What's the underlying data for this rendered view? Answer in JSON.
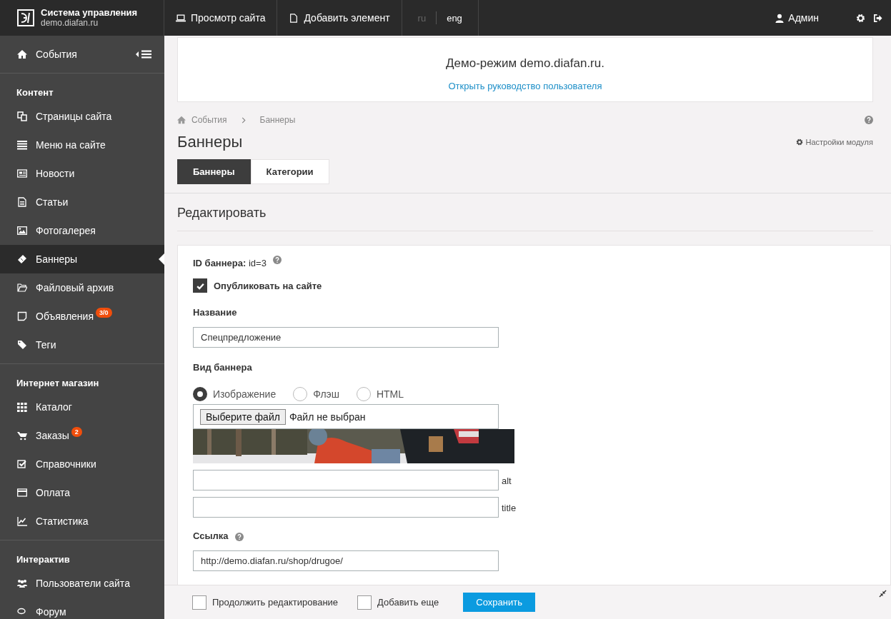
{
  "header": {
    "logo_title": "Система управления",
    "logo_subtitle": "demo.diafan.ru",
    "nav": [
      {
        "label": "Просмотр сайта"
      },
      {
        "label": "Добавить элемент"
      }
    ],
    "languages": [
      {
        "label": "ru",
        "selected": false
      },
      {
        "label": "eng",
        "selected": true
      }
    ],
    "user": "Админ"
  },
  "sidebar": {
    "top": {
      "label": "События"
    },
    "sections": [
      {
        "title": "Контент",
        "items": [
          {
            "label": "Страницы сайта",
            "selected": false
          },
          {
            "label": "Меню на сайте",
            "selected": false
          },
          {
            "label": "Новости",
            "selected": false
          },
          {
            "label": "Статьи",
            "selected": false
          },
          {
            "label": "Фотогалерея",
            "selected": false
          },
          {
            "label": "Баннеры",
            "selected": true
          },
          {
            "label": "Файловый архив",
            "selected": false
          },
          {
            "label": "Объявления",
            "selected": false,
            "badge": "3/0"
          },
          {
            "label": "Теги",
            "selected": false
          }
        ]
      },
      {
        "title": "Интернет магазин",
        "items": [
          {
            "label": "Каталог",
            "selected": false
          },
          {
            "label": "Заказы",
            "selected": false,
            "badge": "2"
          },
          {
            "label": "Справочники",
            "selected": false
          },
          {
            "label": "Оплата",
            "selected": false
          },
          {
            "label": "Статистика",
            "selected": false
          }
        ]
      },
      {
        "title": "Интерактив",
        "items": [
          {
            "label": "Пользователи сайта",
            "selected": false
          },
          {
            "label": "Форум",
            "selected": false
          }
        ]
      }
    ]
  },
  "notice": {
    "text": "Демо-режим demo.diafan.ru.",
    "link": "Открыть руководство пользователя"
  },
  "breadcrumb": [
    "События",
    "Баннеры"
  ],
  "page_title": "Баннеры",
  "settings_link": "Настройки модуля",
  "tabs": [
    {
      "label": "Баннеры",
      "selected": true
    },
    {
      "label": "Категории",
      "selected": false
    }
  ],
  "section_title": "Редактировать",
  "form": {
    "id_label": "ID баннера:",
    "id_value": "id=3",
    "publish": {
      "label": "Опубликовать на сайте",
      "checked": true
    },
    "name": {
      "label": "Название",
      "value": "Спецпредложение"
    },
    "type": {
      "label": "Вид баннера",
      "options": [
        {
          "label": "Изображение",
          "selected": true
        },
        {
          "label": "Флэш",
          "selected": false
        },
        {
          "label": "HTML",
          "selected": false
        }
      ]
    },
    "file": {
      "button": "Выберите файл",
      "status": "Файл не выбран"
    },
    "alt_label": "alt",
    "title_label": "title",
    "link": {
      "label": "Ссылка",
      "value": "http://demo.diafan.ru/shop/drugoe/"
    }
  },
  "footer": {
    "options": [
      {
        "label": "Продолжить редактирование",
        "checked": false
      },
      {
        "label": "Добавить еще",
        "checked": false
      }
    ],
    "save": "Сохранить"
  }
}
